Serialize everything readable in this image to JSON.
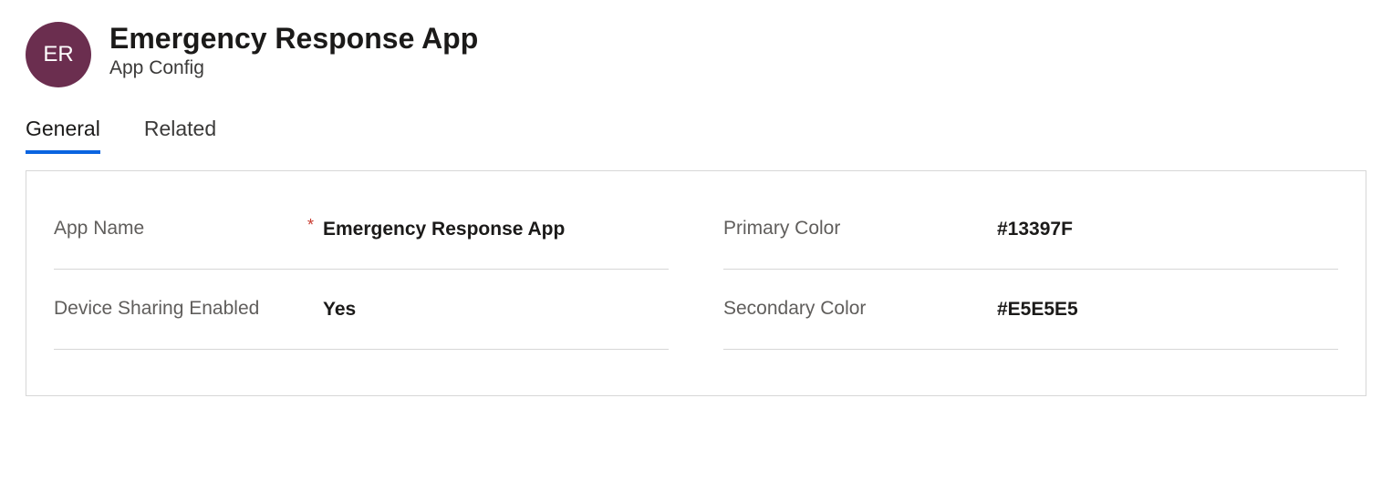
{
  "header": {
    "avatar_initials": "ER",
    "title": "Emergency Response App",
    "subtitle": "App Config"
  },
  "tabs": [
    {
      "label": "General",
      "active": true
    },
    {
      "label": "Related",
      "active": false
    }
  ],
  "form": {
    "left": [
      {
        "label": "App Name",
        "value": "Emergency Response App",
        "required": true
      },
      {
        "label": "Device Sharing Enabled",
        "value": "Yes",
        "required": false
      }
    ],
    "right": [
      {
        "label": "Primary Color",
        "value": "#13397F",
        "required": false
      },
      {
        "label": "Secondary Color",
        "value": "#E5E5E5",
        "required": false
      }
    ]
  }
}
